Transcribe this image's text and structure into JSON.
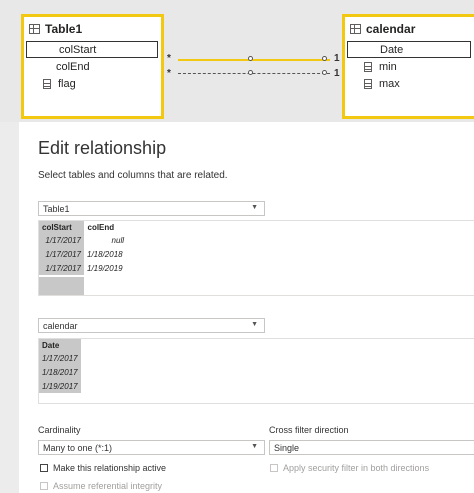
{
  "model": {
    "table1": {
      "name": "Table1",
      "fields": [
        "colStart",
        "colEnd",
        "flag"
      ]
    },
    "calendar": {
      "name": "calendar",
      "fields": [
        "Date",
        "min",
        "max"
      ]
    },
    "relationships": [
      {
        "from_card": "*",
        "to_card": "1",
        "style": "active"
      },
      {
        "from_card": "*",
        "to_card": "1",
        "style": "inactive"
      }
    ]
  },
  "dialog": {
    "title": "Edit relationship",
    "subtitle": "Select tables and columns that are related.",
    "table_a": {
      "selected": "Table1",
      "headers": [
        "colStart",
        "colEnd"
      ],
      "rows": [
        [
          "1/17/2017",
          "null"
        ],
        [
          "1/17/2017",
          "1/18/2018"
        ],
        [
          "1/17/2017",
          "1/19/2019"
        ]
      ]
    },
    "table_b": {
      "selected": "calendar",
      "headers": [
        "Date"
      ],
      "rows": [
        [
          "1/17/2017"
        ],
        [
          "1/18/2017"
        ],
        [
          "1/19/2017"
        ]
      ]
    },
    "cardinality": {
      "label": "Cardinality",
      "value": "Many to one (*:1)"
    },
    "cross_filter": {
      "label": "Cross filter direction",
      "value": "Single"
    },
    "options": {
      "active": {
        "label": "Make this relationship active",
        "checked": false,
        "enabled": true
      },
      "security": {
        "label": "Apply security filter in both directions",
        "checked": false,
        "enabled": false
      },
      "referential": {
        "label": "Assume referential integrity",
        "checked": false,
        "enabled": false
      }
    }
  },
  "colors": {
    "highlight": "#f2c811",
    "header_gray": "#c8c8c8"
  }
}
